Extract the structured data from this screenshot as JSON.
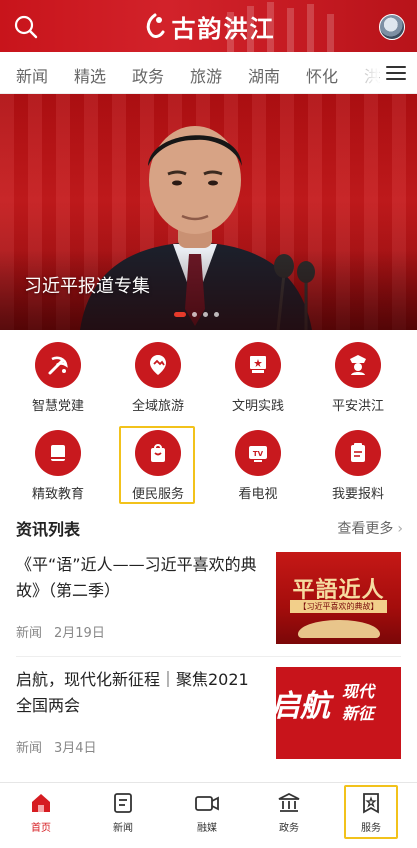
{
  "header": {
    "brand": "古韵洪江",
    "icons": {
      "search": "search-icon",
      "avatar": "user-avatar"
    },
    "colors": {
      "brand_red": "#c8141b"
    }
  },
  "tabs": [
    "新闻",
    "精选",
    "政务",
    "旅游",
    "湖南",
    "怀化",
    "洪"
  ],
  "banner": {
    "caption": "习近平报道专集",
    "slides": 4,
    "active_slide": 1
  },
  "services": [
    {
      "label": "智慧党建",
      "icon": "party-emblem-icon"
    },
    {
      "label": "全域旅游",
      "icon": "tourism-pin-icon"
    },
    {
      "label": "文明实践",
      "icon": "flag-icon"
    },
    {
      "label": "平安洪江",
      "icon": "police-badge-icon"
    },
    {
      "label": "精致教育",
      "icon": "book-icon"
    },
    {
      "label": "便民服务",
      "icon": "shopping-bag-icon",
      "highlighted": true
    },
    {
      "label": "看电视",
      "icon": "tv-icon"
    },
    {
      "label": "我要报料",
      "icon": "report-form-icon"
    }
  ],
  "news_section": {
    "title": "资讯列表",
    "more": "查看更多"
  },
  "news": [
    {
      "title": "《平“语”近人——习近平喜欢的典故》（第二季）",
      "category": "新闻",
      "date": "2月19日",
      "thumb": {
        "headline": "平語近人",
        "subtitle": "【习近平喜欢的典故】"
      }
    },
    {
      "title": "启航，现代化新征程｜聚焦2021全国两会",
      "category": "新闻",
      "date": "3月4日",
      "thumb": {
        "big": "启航",
        "small_line1": "现代",
        "small_line2": "新征"
      }
    }
  ],
  "bottom_nav": [
    {
      "label": "首页",
      "icon": "home-icon",
      "active": true
    },
    {
      "label": "新闻",
      "icon": "news-icon"
    },
    {
      "label": "融媒",
      "icon": "video-camera-icon"
    },
    {
      "label": "政务",
      "icon": "government-building-icon"
    },
    {
      "label": "服务",
      "icon": "service-badge-icon",
      "highlighted": true
    }
  ]
}
